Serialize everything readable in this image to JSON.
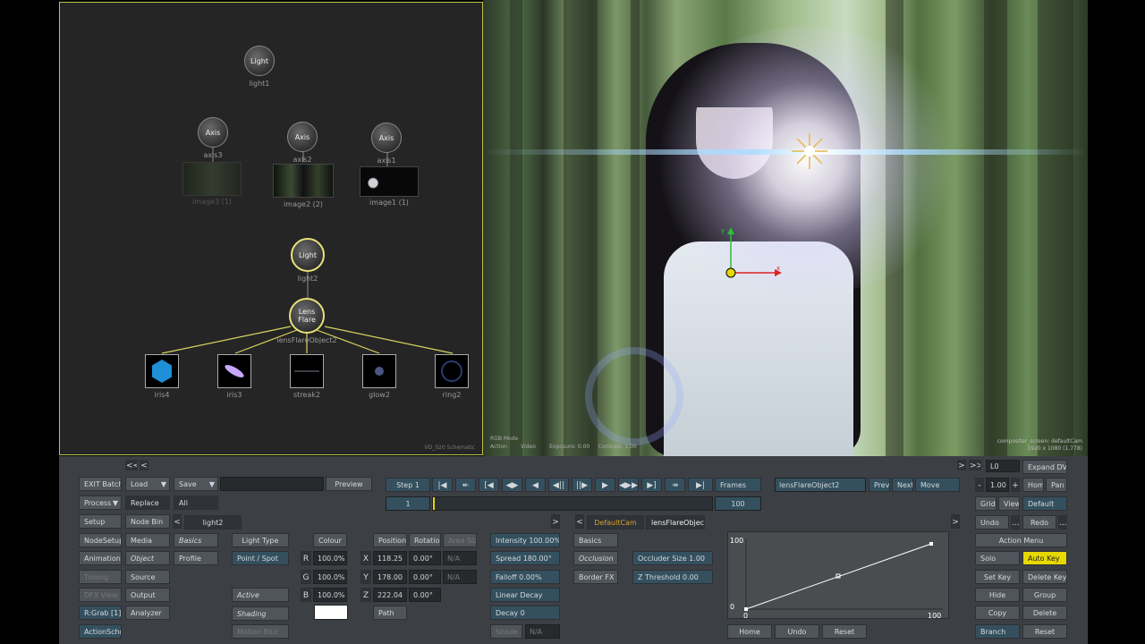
{
  "schematic": {
    "nodes": [
      {
        "label": "Light",
        "name": "light1"
      },
      {
        "label": "Axis",
        "name": "axis3"
      },
      {
        "label": "Axis",
        "name": "axis2"
      },
      {
        "label": "Axis",
        "name": "axis1"
      },
      {
        "label": "Light",
        "name": "light2"
      },
      {
        "label": "Lens\nFlare",
        "name": "lensFlareObject2"
      }
    ],
    "images": [
      "image3 (1)",
      "image2 (2)",
      "image1 (1)"
    ],
    "flare_elems": [
      "iris4",
      "iris3",
      "streak2",
      "glow2",
      "ring2"
    ],
    "footer": "VD_020 Schematic"
  },
  "viewer": {
    "info1": "RGB Mode",
    "info2a": "Action",
    "info2b": "Video",
    "info2c": "Exposure: 0.00",
    "info2d": "Contrast: 1.00",
    "res1": "compositer_screen: defaultCam",
    "res2": "1920 x 1080 (1.778)",
    "axis_x": "x",
    "axis_y": "y"
  },
  "panel": {
    "left": {
      "exit": "EXIT Batch",
      "load": "Load",
      "save": "Save",
      "process": "Process",
      "replace": "Replace",
      "all": "All",
      "setup": "Setup",
      "nodebin": "Node Bin",
      "nodesetup": "NodeSetup",
      "media": "Media",
      "basics": "Basics",
      "animation": "Animation",
      "object": "Object",
      "profile": "Profile",
      "timing": "Timing",
      "source": "Source",
      "dfxview": "DFX View",
      "output": "Output",
      "rgrab": "R:Grab [1]",
      "analyzer": "Analyzer",
      "actionschm": "ActionSchm",
      "light_tab": "light2"
    },
    "transport": {
      "preview": "Preview",
      "step": "Step 1",
      "frames": "Frames",
      "frame": "1",
      "end": "100",
      "nav_back": "<<",
      "nav_fwd": ">>"
    },
    "obj": {
      "name": "lensFlareObject2",
      "prev": "Prev",
      "next": "Next",
      "move": "Move",
      "cam": "DefaultCam",
      "tab_name": "lensFlareObject2"
    },
    "light": {
      "type_label": "Light Type",
      "type": "Point / Spot",
      "active": "Active",
      "shading": "Shading",
      "motion_blur": "Motion Blur",
      "colour": "Colour",
      "r_label": "R",
      "r": "100.0%",
      "g_label": "G",
      "g": "100.0%",
      "b_label": "B",
      "b": "100.0%",
      "swatch": "#ffffff"
    },
    "xform": {
      "position": "Position",
      "rotation": "Rotation",
      "area_size": "Area Size",
      "x_label": "X",
      "x": "118.25",
      "xr": "0.00°",
      "xa": "N/A",
      "y_label": "Y",
      "y": "178.00",
      "yr": "0.00°",
      "ya": "N/A",
      "z_label": "Z",
      "z": "222.04",
      "zr": "0.00°",
      "path": "Path"
    },
    "flare": {
      "intensity": "Intensity 100.00%",
      "spread": "Spread 180.00°",
      "falloff": "Falloff 0.00%",
      "linear_decay": "Linear Decay",
      "decay": "Decay 0",
      "shade": "Shade",
      "shade_val": "N/A",
      "basics": "Basics",
      "occlusion": "Occlusion",
      "border": "Border FX",
      "occ_size": "Occluder Size 1.00",
      "zthresh": "Z Threshold 0.00"
    },
    "curve": {
      "y_max": "100",
      "y_min": "0",
      "x_min": "0",
      "x_max": "100",
      "home": "Home",
      "undo": "Undo",
      "reset": "Reset"
    },
    "right": {
      "l0": "L0",
      "expand": "Expand DVE",
      "minus": "-",
      "zoom": "1.00",
      "plus": "+",
      "home": "Home",
      "pan": "Pan",
      "grid": "Grid",
      "view": "View",
      "default": "Default",
      "undo": "Undo",
      "redo": "Redo",
      "more": "...",
      "action_menu": "Action Menu",
      "solo": "Solo",
      "autokey": "Auto Key",
      "setkey": "Set Key",
      "deletekey": "Delete Key",
      "hide": "Hide",
      "group": "Group",
      "copy": "Copy",
      "delete": "Delete",
      "branch": "Branch",
      "reset": "Reset"
    }
  }
}
